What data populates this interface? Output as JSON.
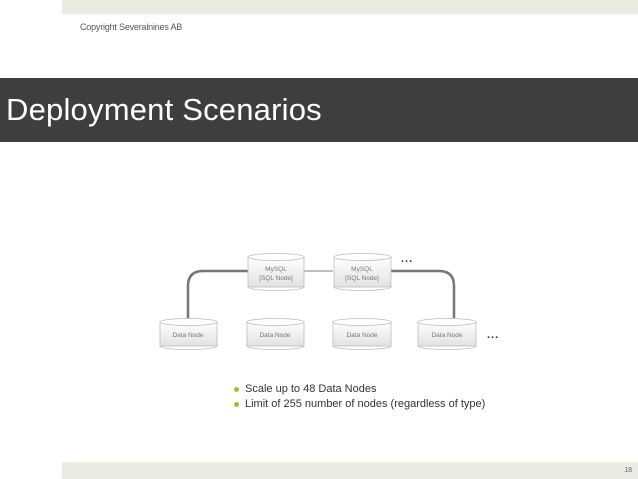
{
  "header": {
    "copyright": "Copyright Severalnines AB",
    "title": "Deployment Scenarios"
  },
  "diagram": {
    "sql_nodes": [
      {
        "line1": "MySQL",
        "line2": "[SQL Node]"
      },
      {
        "line1": "MySQL",
        "line2": "[SQL Node]"
      }
    ],
    "data_nodes": [
      "Data Node",
      "Data Node",
      "Data Node",
      "Data Node"
    ],
    "sql_ellipsis": "...",
    "data_ellipsis": "..."
  },
  "bullets": [
    "Scale up to 48 Data Nodes",
    "Limit of 255 number of nodes (regardless of type)"
  ],
  "footer": {
    "page_number": "18"
  },
  "colors": {
    "title_bar": "#3e3e3e",
    "accent_bullet": "#a8b83d",
    "strip": "#ebeae3"
  }
}
